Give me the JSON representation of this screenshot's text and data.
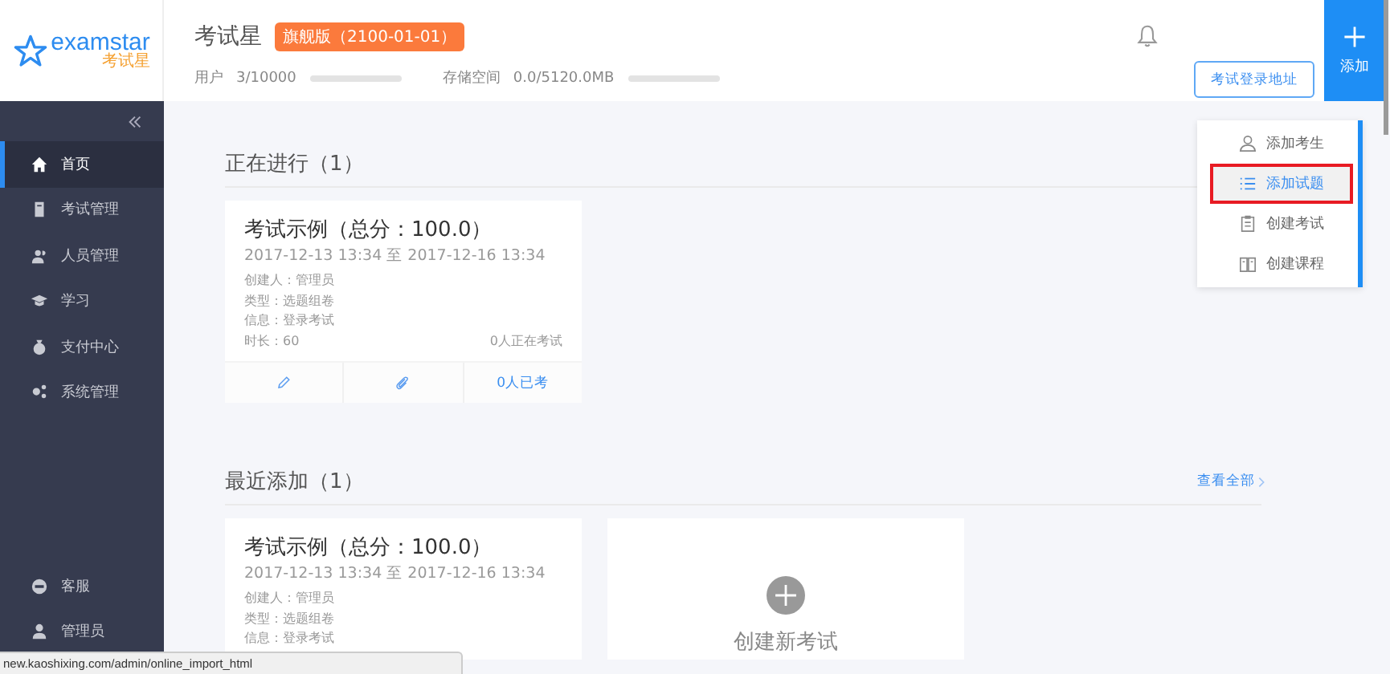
{
  "logo": {
    "name": "examstar",
    "subtitle": "考试星"
  },
  "header": {
    "title": "考试星",
    "badge": "旗舰版（2100-01-01）",
    "stats": [
      {
        "label": "用户",
        "value": "3/10000",
        "level": 0.0003
      },
      {
        "label": "存储空间",
        "value": "0.0/5120.0MB",
        "level": 0
      }
    ],
    "login_button": "考试登录地址",
    "add_button": "添加"
  },
  "sidebar": {
    "items": [
      {
        "label": "首页",
        "selected": true
      },
      {
        "label": "考试管理",
        "selected": false
      },
      {
        "label": "人员管理",
        "selected": false
      },
      {
        "label": "学习",
        "selected": false
      },
      {
        "label": "支付中心",
        "selected": false
      },
      {
        "label": "系统管理",
        "selected": false
      }
    ],
    "bottom": [
      {
        "label": "客服"
      },
      {
        "label": "管理员"
      }
    ]
  },
  "add_menu": [
    {
      "label": "添加考生",
      "selected": false
    },
    {
      "label": "添加试题",
      "selected": true
    },
    {
      "label": "创建考试",
      "selected": false
    },
    {
      "label": "创建课程",
      "selected": false
    }
  ],
  "sections": [
    {
      "title": "正在进行（1）",
      "cards": [
        {
          "title": "考试示例（总分：100.0）",
          "dates": "2017-12-13 13:34 至 2017-12-16 13:34",
          "lines": [
            "创建人：管理员",
            "类型：选题组卷",
            "信息：登录考试",
            "时长：60"
          ],
          "status": "0人正在考试",
          "footer": "0人已考"
        }
      ]
    },
    {
      "title": "最近添加（1）",
      "link": "查看全部",
      "cards": [
        {
          "title": "考试示例（总分：100.0）",
          "dates": "2017-12-13 13:34 至 2017-12-16 13:34",
          "lines": [
            "创建人：管理员",
            "类型：选题组卷",
            "信息：登录考试"
          ]
        }
      ],
      "new_card": "创建新考试"
    }
  ],
  "status_url": "new.kaoshixing.com/admin/online_import_html"
}
